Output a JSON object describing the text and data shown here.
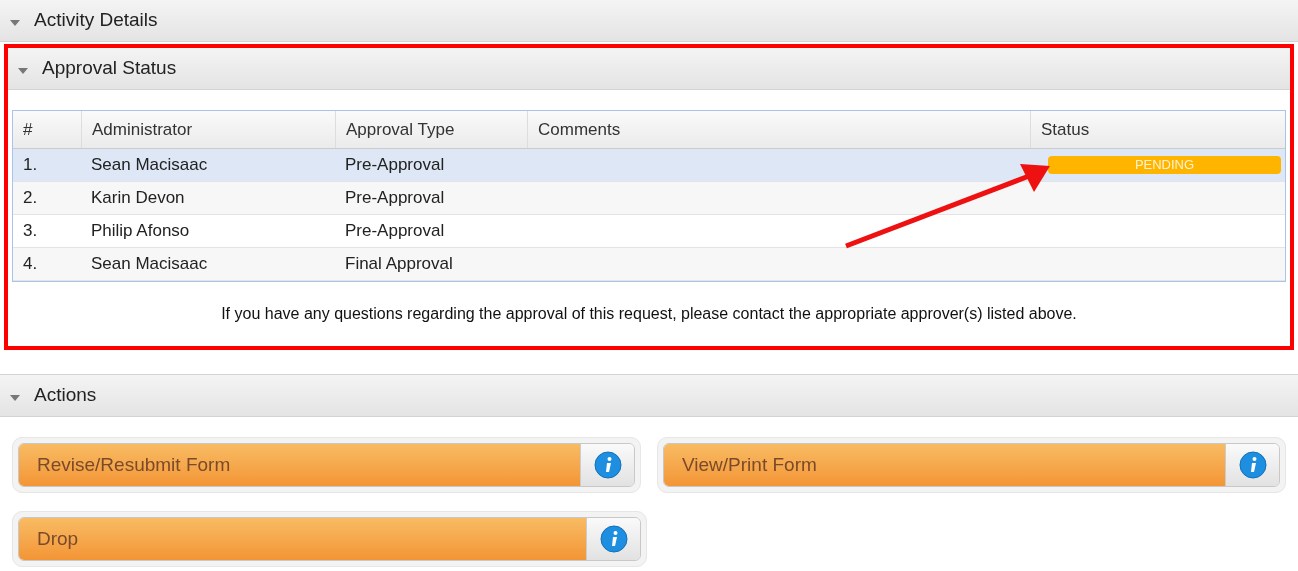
{
  "sections": [
    {
      "title": "Activity Details",
      "expanded": true
    },
    {
      "title": "Approval Status",
      "expanded": true
    },
    {
      "title": "Actions",
      "expanded": true
    }
  ],
  "table": {
    "columns": [
      "#",
      "Administrator",
      "Approval Type",
      "Comments",
      "Status"
    ],
    "rows": [
      {
        "number": "1.",
        "administrator": "Sean Macisaac",
        "approval_type": "Pre-Approval",
        "status": "PENDING",
        "selected": true
      },
      {
        "number": "2.",
        "administrator": "Karin Devon",
        "approval_type": "Pre-Approval",
        "selected": false
      },
      {
        "number": "3.",
        "administrator": "Philip Afonso",
        "approval_type": "Pre-Approval",
        "selected": false
      },
      {
        "number": "4.",
        "administrator": "Sean Macisaac",
        "approval_type": "Final Approval",
        "selected": false
      }
    ]
  },
  "note": "If you have any questions regarding the approval of this request, please contact the appropriate approver(s) listed above.",
  "actions": [
    {
      "label": "Revise/Resubmit Form"
    },
    {
      "label": "View/Print Form"
    },
    {
      "label": "Drop"
    }
  ]
}
